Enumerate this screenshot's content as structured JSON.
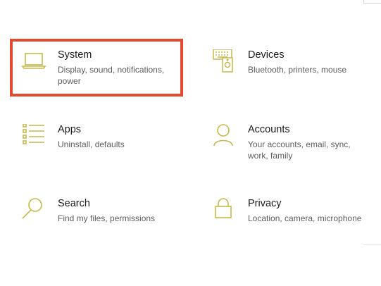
{
  "accent_color": "#c7b84a",
  "highlight_color": "#e64a2e",
  "tiles": [
    {
      "title": "System",
      "description": "Display, sound, notifications, power",
      "icon": "laptop-icon"
    },
    {
      "title": "Devices",
      "description": "Bluetooth, printers, mouse",
      "icon": "keyboard-speaker-icon"
    },
    {
      "title": "Apps",
      "description": "Uninstall, defaults",
      "icon": "app-list-icon"
    },
    {
      "title": "Accounts",
      "description": "Your accounts, email, sync, work, family",
      "icon": "person-icon"
    },
    {
      "title": "Search",
      "description": "Find my files, permissions",
      "icon": "magnifier-icon"
    },
    {
      "title": "Privacy",
      "description": "Location, camera, microphone",
      "icon": "lock-icon"
    }
  ]
}
